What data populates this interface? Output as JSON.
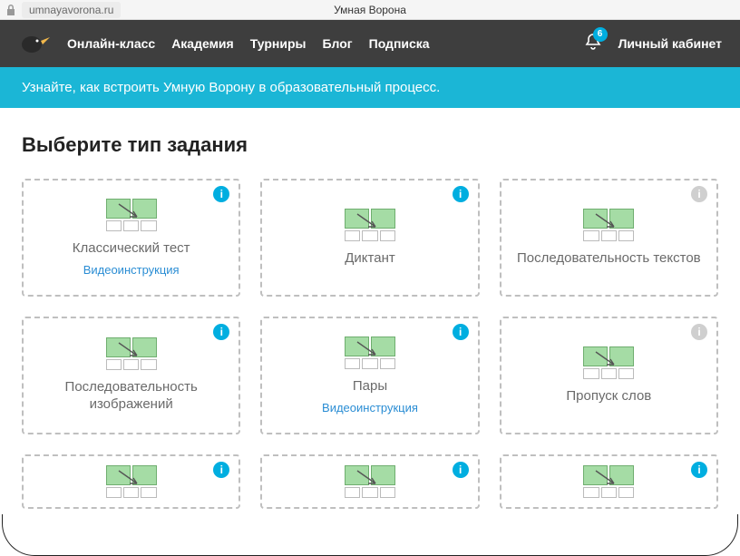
{
  "browser": {
    "url": "umnayavorona.ru",
    "title": "Умная Ворона"
  },
  "nav": {
    "items": [
      "Онлайн-класс",
      "Академия",
      "Турниры",
      "Блог",
      "Подписка"
    ],
    "notifications": "6",
    "account": "Личный кабинет"
  },
  "banner": {
    "text": "Узнайте, как встроить Умную Ворону в образовательный процесс."
  },
  "heading": "Выберите тип задания",
  "cards": [
    {
      "title": "Классический тест",
      "link": "Видеоинструкция",
      "info_disabled": false
    },
    {
      "title": "Диктант",
      "link": "",
      "info_disabled": false
    },
    {
      "title": "Последовательность текстов",
      "link": "",
      "info_disabled": true
    },
    {
      "title": "Последовательность изображений",
      "link": "",
      "info_disabled": false
    },
    {
      "title": "Пары",
      "link": "Видеоинструкция",
      "info_disabled": false
    },
    {
      "title": "Пропуск слов",
      "link": "",
      "info_disabled": true
    },
    {
      "title": "",
      "link": "",
      "info_disabled": false
    },
    {
      "title": "",
      "link": "",
      "info_disabled": false
    },
    {
      "title": "",
      "link": "",
      "info_disabled": false
    }
  ]
}
